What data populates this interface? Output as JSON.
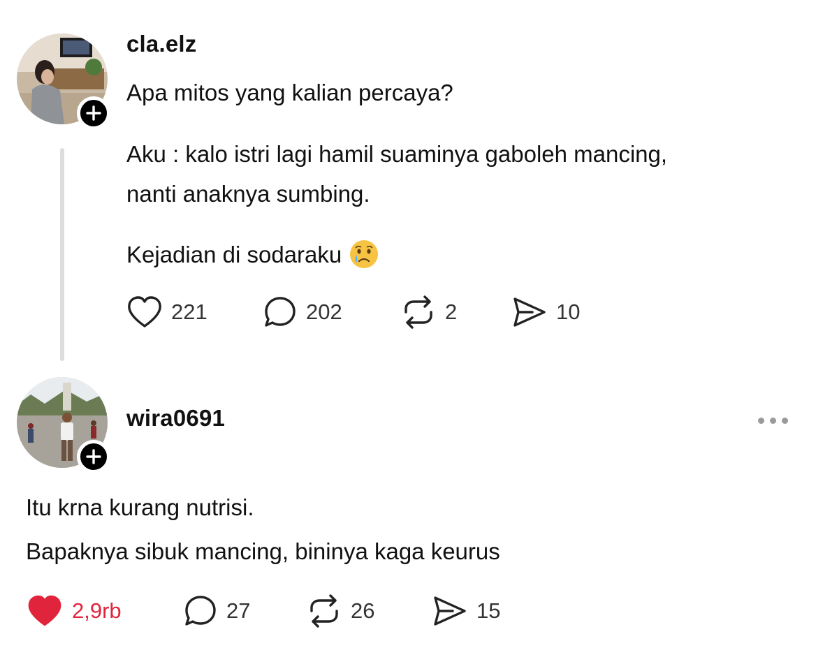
{
  "post": {
    "username": "cla.elz",
    "paragraphs": [
      "Apa mitos yang kalian percaya?",
      "Aku : kalo istri lagi hamil suaminya gaboleh mancing,",
      "nanti anaknya sumbing.",
      "Kejadian di sodaraku"
    ],
    "emoji": "crying-face",
    "actions": {
      "likes": "221",
      "comments": "202",
      "reposts": "2",
      "shares": "10"
    }
  },
  "reply": {
    "username": "wira0691",
    "paragraphs": [
      "Itu krna kurang nutrisi.",
      "Bapaknya sibuk mancing, bininya kaga keurus"
    ],
    "actions": {
      "likes": "2,9rb",
      "comments": "27",
      "reposts": "26",
      "shares": "15"
    },
    "liked": true
  },
  "colors": {
    "like_active": "#e0243c",
    "text": "#111111",
    "muted": "#333333",
    "thread_line": "#dddddd"
  },
  "icons": [
    "plus-icon",
    "heart-icon",
    "comment-icon",
    "repost-icon",
    "share-icon",
    "more-icon"
  ]
}
